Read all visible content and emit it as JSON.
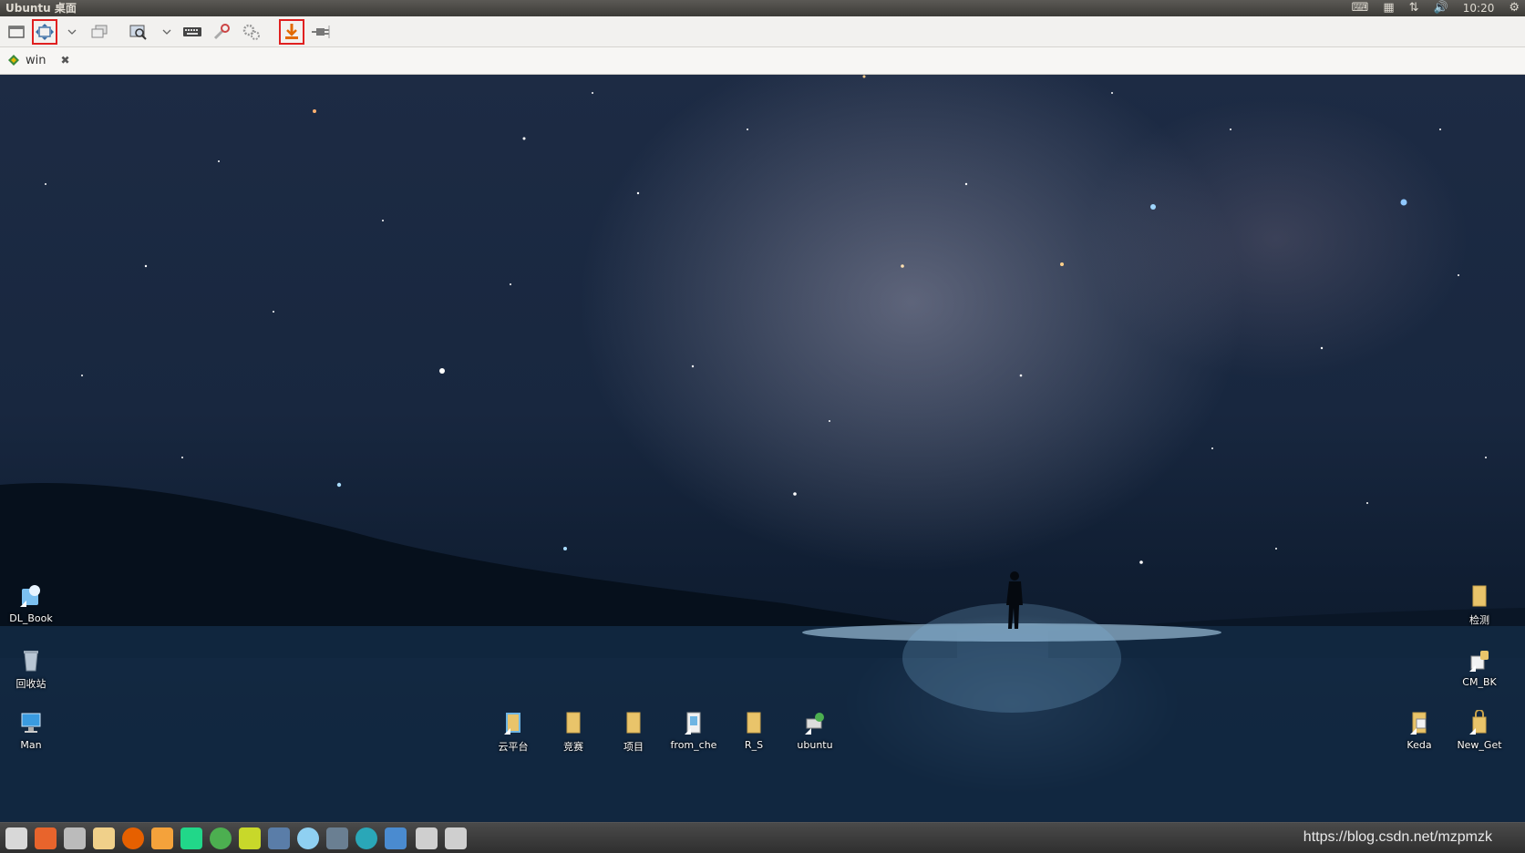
{
  "top_panel": {
    "title": "Ubuntu 桌面",
    "clock": "10:20"
  },
  "tab": {
    "label": "win"
  },
  "desktop_icons": {
    "dl_book": "DL_Book",
    "recycle": "回收站",
    "man": "Man",
    "yunpingtai": "云平台",
    "jingsai": "竞赛",
    "xiangmu": "项目",
    "from_che": "from_che",
    "r_s": "R_S",
    "ubuntu": "ubuntu",
    "jiance": "检测",
    "cm_bk": "CM_BK",
    "keda": "Keda",
    "new_get": "New_Get"
  },
  "watermark": "https://blog.csdn.net/mzpmzk",
  "colors": {
    "panel": "#3c3b37",
    "highlight": "#e02020",
    "folder": "#e9c46a",
    "taskbar": "#333333"
  }
}
